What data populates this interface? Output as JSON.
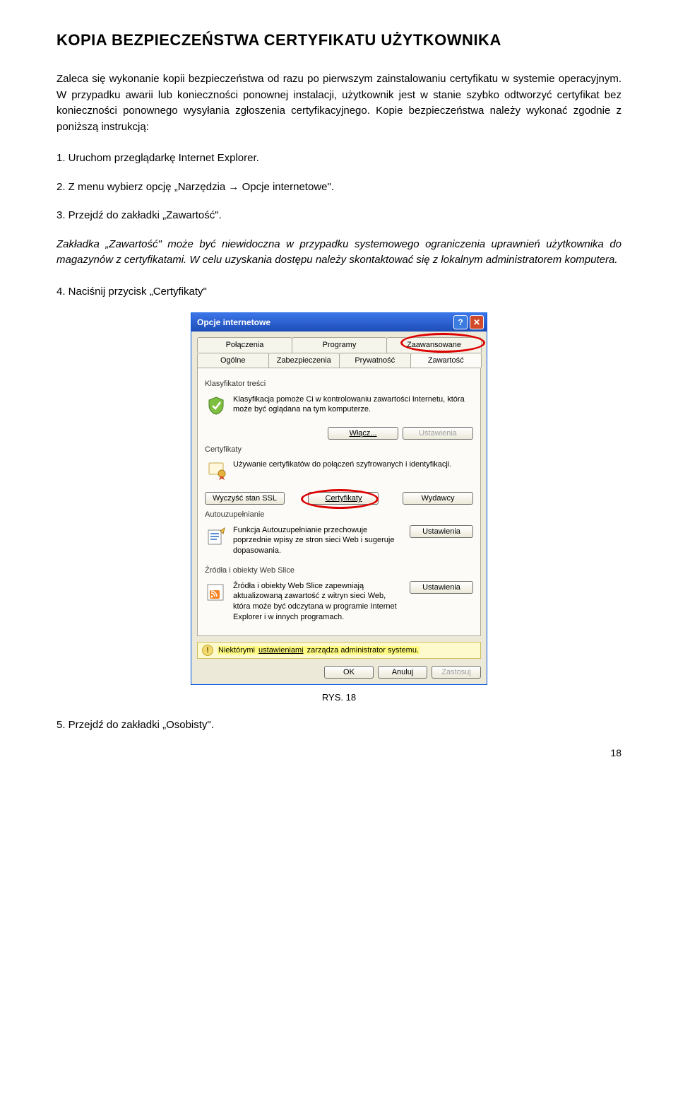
{
  "title": "KOPIA BEZPIECZEŃSTWA CERTYFIKATU UŻYTKOWNIKA",
  "para1": "Zaleca się wykonanie kopii bezpieczeństwa od razu po pierwszym zainstalowaniu certyfikatu w systemie operacyjnym. W przypadku awarii lub konieczności ponownej instalacji, użytkownik jest w stanie szybko odtworzyć certyfikat bez konieczności ponownego wysyłania zgłoszenia certyfikacyjnego. Kopie bezpieczeństwa należy wykonać zgodnie z poniższą instrukcją:",
  "step1": "1. Uruchom przeglądarkę Internet Explorer.",
  "step2": "2. Z menu wybierz opcję „Narzędzia → Opcje internetowe\".",
  "step3": "3. Przejdź do zakładki „Zawartość\".",
  "step3note": "Zakładka „Zawartość\" może być niewidoczna w przypadku systemowego ograniczenia uprawnień użytkownika do magazynów z certyfikatami. W celu uzyskania dostępu należy skontaktować się z lokalnym administratorem komputera.",
  "step4": "4. Naciśnij przycisk „Certyfikaty\"",
  "dialog": {
    "title": "Opcje internetowe",
    "tabs_row1": [
      "Połączenia",
      "Programy",
      "Zaawansowane"
    ],
    "tabs_row2": [
      "Ogólne",
      "Zabezpieczenia",
      "Prywatność",
      "Zawartość"
    ],
    "klas_label": "Klasyfikator treści",
    "klas_desc": "Klasyfikacja pomoże Ci w kontrolowaniu zawartości Internetu, która może być oglądana na tym komputerze.",
    "btn_wlacz": "Włącz...",
    "btn_ustawienia": "Ustawienia",
    "cert_label": "Certyfikaty",
    "cert_desc": "Używanie certyfikatów do połączeń szyfrowanych i identyfikacji.",
    "btn_wyczysc": "Wyczyść stan SSL",
    "btn_certy": "Certyfikaty",
    "btn_wydawcy": "Wydawcy",
    "auto_label": "Autouzupełnianie",
    "auto_desc": "Funkcja Autouzupełnianie przechowuje poprzednie wpisy ze stron sieci Web i sugeruje dopasowania.",
    "rss_label": "Źródła i obiekty Web Slice",
    "rss_desc": "Źródła i obiekty Web Slice zapewniają aktualizowaną zawartość z witryn sieci Web, która może być odczytana w programie Internet Explorer i w innych programach.",
    "warn_pre": "Niektórymi ",
    "warn_link": "ustawieniami",
    "warn_post": " zarządza administrator systemu.",
    "ok": "OK",
    "cancel": "Anuluj",
    "apply": "Zastosuj"
  },
  "caption": "RYS. 18",
  "step5": "5. Przejdź do zakładki „Osobisty\".",
  "pagenum": "18"
}
